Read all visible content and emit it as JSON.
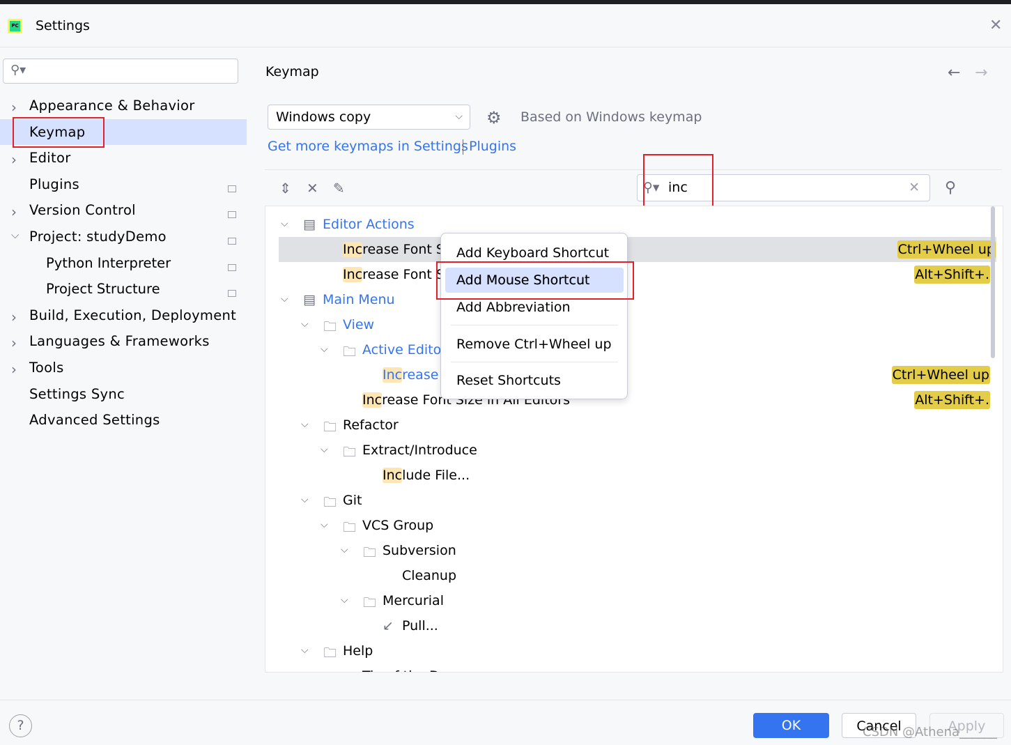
{
  "window": {
    "title": "Settings",
    "app_icon": "PC"
  },
  "search": {
    "value": "",
    "icon": "search-icon"
  },
  "sidebar": {
    "items": [
      {
        "label": "Appearance & Behavior",
        "expandable": true,
        "level": 0
      },
      {
        "label": "Keymap",
        "selected": true,
        "level": 0
      },
      {
        "label": "Editor",
        "expandable": true,
        "level": 0
      },
      {
        "label": "Plugins",
        "level": 0,
        "project_badge": true
      },
      {
        "label": "Version Control",
        "expandable": true,
        "level": 0,
        "project_badge": true
      },
      {
        "label": "Project: studyDemo",
        "expanded": true,
        "level": 0,
        "project_badge": true
      },
      {
        "label": "Python Interpreter",
        "level": 1,
        "project_badge": true
      },
      {
        "label": "Project Structure",
        "level": 1,
        "project_badge": true
      },
      {
        "label": "Build, Execution, Deployment",
        "expandable": true,
        "level": 0
      },
      {
        "label": "Languages & Frameworks",
        "expandable": true,
        "level": 0
      },
      {
        "label": "Tools",
        "expandable": true,
        "level": 0
      },
      {
        "label": "Settings Sync",
        "level": 0
      },
      {
        "label": "Advanced Settings",
        "level": 0
      }
    ]
  },
  "main": {
    "heading": "Keymap",
    "keymap_select": "Windows copy",
    "based_on": "Based on Windows keymap",
    "link_keymaps": "Get more keymaps in Settings",
    "link_plugins": "Plugins",
    "filter": {
      "value": "inc"
    },
    "tree": [
      {
        "label": "Editor Actions",
        "level": 0,
        "chevron": true,
        "icon": "editor-actions-icon",
        "blue": true
      },
      {
        "label": "Increase Font Size",
        "level": 1,
        "hl": 3,
        "selected": true,
        "shortcut": "Ctrl+Wheel up"
      },
      {
        "label": "Increase Font Size",
        "level": 1,
        "hl": 3,
        "shortcut": "Alt+Shift+."
      },
      {
        "label": "Main Menu",
        "level": 0,
        "chevron": true,
        "icon": "main-menu-icon",
        "blue": true
      },
      {
        "label": "View",
        "level": 1,
        "chevron": true,
        "icon": "folder-icon",
        "blue": true
      },
      {
        "label": "Active Editor",
        "level": 2,
        "chevron": true,
        "icon": "folder-icon",
        "blue": true
      },
      {
        "label": "Increase",
        "level": 3,
        "hl": 3,
        "blue": true,
        "shortcut": "Ctrl+Wheel up"
      },
      {
        "label": "Increase Font Size in All Editors",
        "level": 2,
        "hl": 3,
        "shortcut": "Alt+Shift+."
      },
      {
        "label": "Refactor",
        "level": 1,
        "chevron": true,
        "icon": "folder-icon"
      },
      {
        "label": "Extract/Introduce",
        "level": 2,
        "chevron": true,
        "icon": "folder-icon"
      },
      {
        "label": "Include File...",
        "level": 3,
        "hl": 3
      },
      {
        "label": "Git",
        "level": 1,
        "chevron": true,
        "icon": "folder-icon"
      },
      {
        "label": "VCS Group",
        "level": 2,
        "chevron": true,
        "icon": "folder-icon"
      },
      {
        "label": "Subversion",
        "level": 3,
        "chevron": true,
        "icon": "folder-icon"
      },
      {
        "label": "Cleanup",
        "level": 4
      },
      {
        "label": "Mercurial",
        "level": 3,
        "chevron": true,
        "icon": "folder-icon"
      },
      {
        "label": "Pull...",
        "level": 4,
        "icon": "pull-arrow-icon"
      },
      {
        "label": "Help",
        "level": 1,
        "chevron": true,
        "icon": "folder-icon"
      },
      {
        "label": "Tip of the Day",
        "level": 2
      }
    ]
  },
  "context_menu": {
    "items": [
      "Add Keyboard Shortcut",
      "Add Mouse Shortcut",
      "Add Abbreviation",
      "Remove Ctrl+Wheel up",
      "Reset Shortcuts"
    ],
    "highlighted": "Add Mouse Shortcut"
  },
  "footer": {
    "ok": "OK",
    "cancel": "Cancel",
    "apply": "Apply",
    "help": "?"
  },
  "watermark": "CSDN @Athena______",
  "colors": {
    "accent": "#3574f0",
    "selection": "#d5e1ff",
    "match_highlight": "#fde6b3",
    "shortcut_badge": "#e2cc48",
    "annotation": "#e0202a"
  }
}
